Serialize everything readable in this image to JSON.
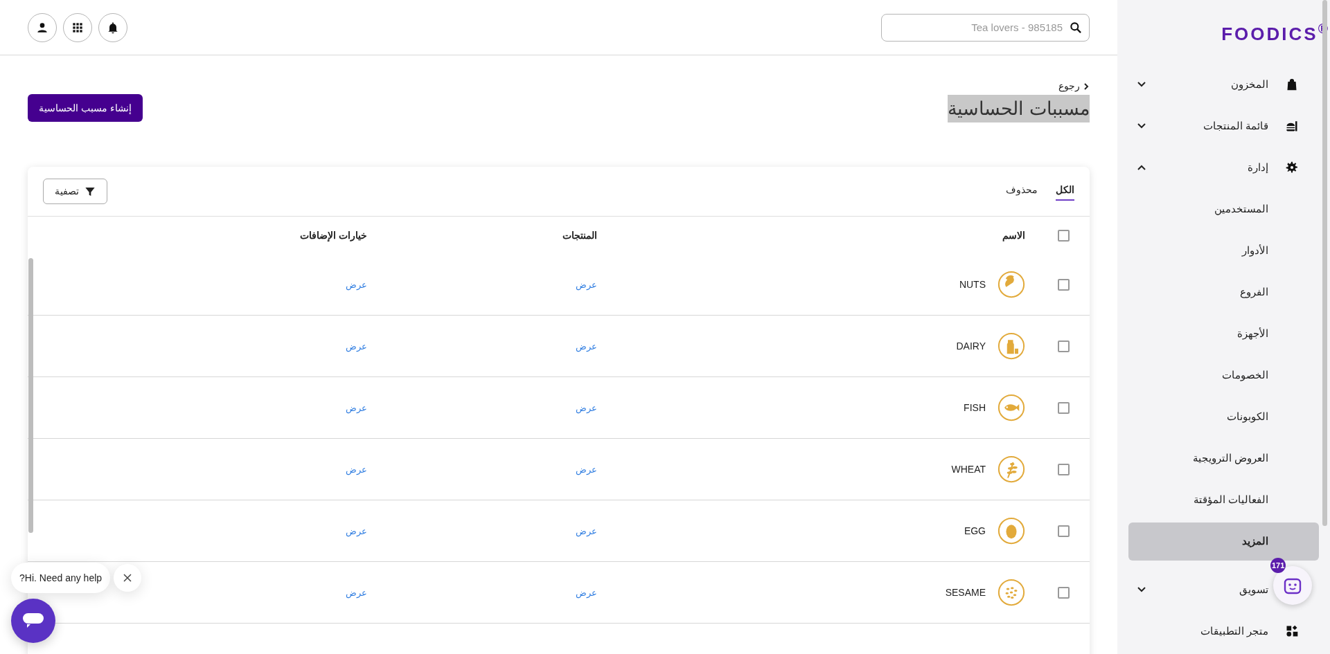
{
  "sidebar": {
    "logo": "FOODICS$^{®}$",
    "items": [
      {
        "label": "المخزون",
        "expanded": false
      },
      {
        "label": "قائمة المنتجات",
        "expanded": false
      },
      {
        "label": "إدارة",
        "expanded": true,
        "children": [
          {
            "label": "المستخدمين",
            "selected": false
          },
          {
            "label": "الأدوار",
            "selected": false
          },
          {
            "label": "الفروع",
            "selected": false
          },
          {
            "label": "الأجهزة",
            "selected": false
          },
          {
            "label": "الخصومات",
            "selected": false
          },
          {
            "label": "الكوبونات",
            "selected": false
          },
          {
            "label": "العروض الترويجية",
            "selected": false
          },
          {
            "label": "الفعاليات المؤقتة",
            "selected": false
          },
          {
            "label": "المزيد",
            "selected": true
          }
        ]
      },
      {
        "label": "تسويق",
        "expanded": false
      },
      {
        "label": "متجر التطبيقات"
      }
    ]
  },
  "header": {
    "search": {
      "placeholder": "Tea lovers - 985185"
    }
  },
  "page": {
    "back": "رجوع",
    "title": "مسببات الحساسية",
    "create_button": "إنشاء مسبب الحساسية"
  },
  "tabs": [
    {
      "label": "الكل",
      "selected": true
    },
    {
      "label": "محذوف",
      "selected": false
    }
  ],
  "filter_button": "تصفية",
  "table": {
    "all_checked": false,
    "columns": [
      "الاسم",
      "المنتجات",
      "خيارات الإضافات"
    ],
    "rows": [
      {
        "name": "NUTS",
        "products": "عرض",
        "modifiers": "عرض",
        "checked": false
      },
      {
        "name": "DAIRY",
        "products": "عرض",
        "modifiers": "عرض",
        "checked": false
      },
      {
        "name": "FISH",
        "products": "عرض",
        "modifiers": "عرض",
        "checked": false
      },
      {
        "name": "WHEAT",
        "products": "عرض",
        "modifiers": "عرض",
        "checked": false
      },
      {
        "name": "EGG",
        "products": "عرض",
        "modifiers": "عرض",
        "checked": false
      },
      {
        "name": "SESAME",
        "products": "عرض",
        "modifiers": "عرض",
        "checked": false
      }
    ]
  },
  "assistant": {
    "badge": "171"
  },
  "help_chat": {
    "message": "?Hi. Need any help"
  }
}
